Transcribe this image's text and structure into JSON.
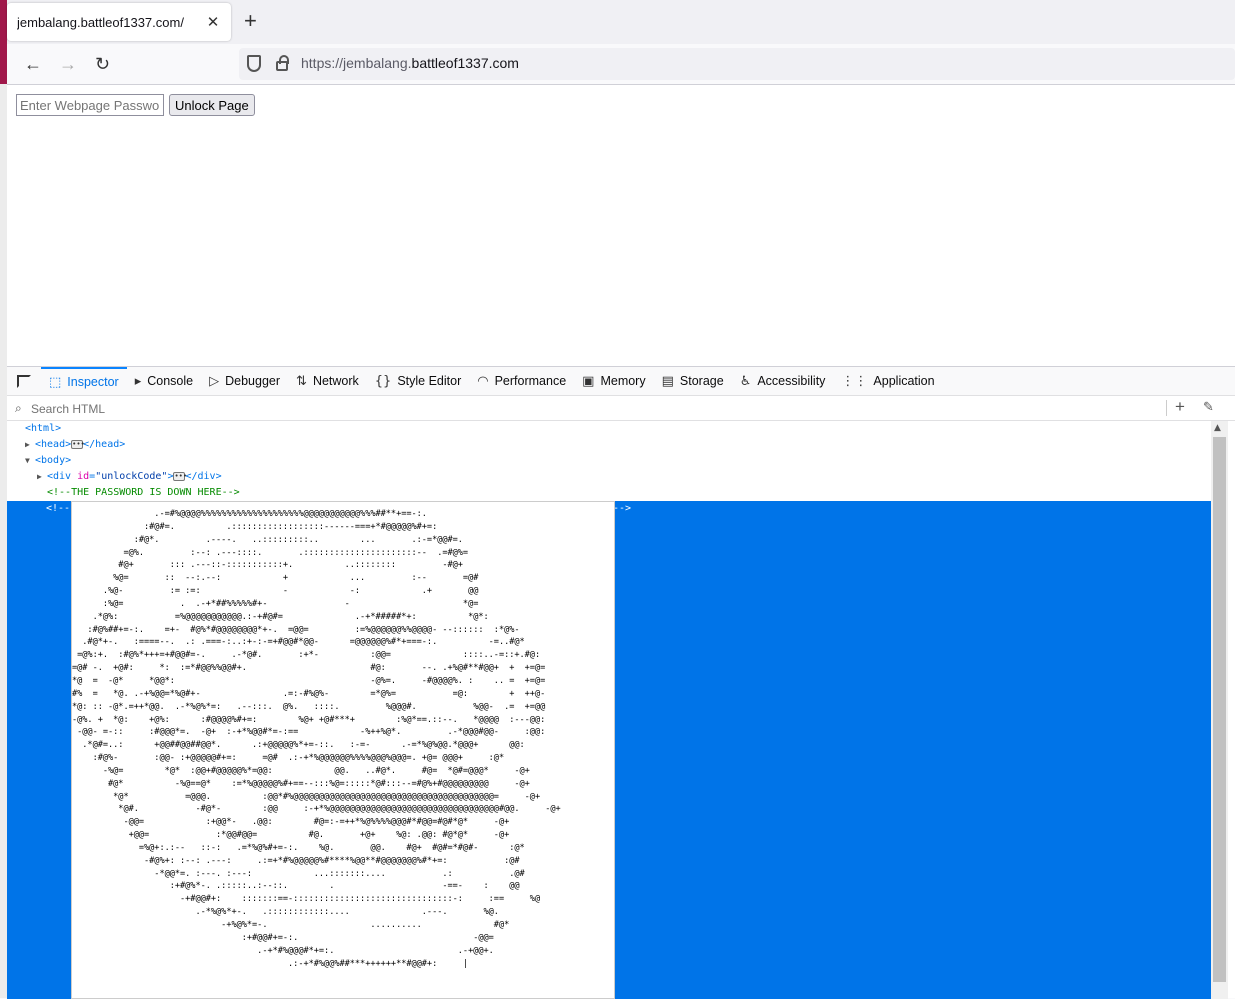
{
  "browser": {
    "tab_title": "jembalang.battleof1337.com/",
    "tab_close": "✕",
    "new_tab": "+",
    "url_prefix": "https://",
    "url_domain_plain": "jembalang.",
    "url_domain": "battleof1337.com"
  },
  "page": {
    "password_placeholder": "Enter Webpage Password",
    "unlock_label": "Unlock Page"
  },
  "devtools": {
    "tabs": [
      {
        "label": "Inspector",
        "icon": "⬚"
      },
      {
        "label": "Console",
        "icon": "▸"
      },
      {
        "label": "Debugger",
        "icon": "▷"
      },
      {
        "label": "Network",
        "icon": "⇅"
      },
      {
        "label": "Style Editor",
        "icon": "{}"
      },
      {
        "label": "Performance",
        "icon": "◠"
      },
      {
        "label": "Memory",
        "icon": "▣"
      },
      {
        "label": "Storage",
        "icon": "▤"
      },
      {
        "label": "Accessibility",
        "icon": "♿"
      },
      {
        "label": "Application",
        "icon": "⋮⋮"
      }
    ],
    "search_placeholder": "Search HTML",
    "markup": {
      "html_open": "<html>",
      "head_open": "<head>",
      "head_close": "</head>",
      "body_open": "<body>",
      "div_open_start": "<div ",
      "div_attr": "id",
      "div_val": "\"unlockCode\"",
      "div_open_end": ">",
      "div_close": "</div>",
      "comment1": "<!--THE PASSWORD IS DOWN HERE-->",
      "comment2_open": "<!--",
      "comment2_close": "-->",
      "ascii_art": "                .-=#%@@@@%%%%%%%%%%%%%%%%%%%%@@@@@@@@@@@%%%##**+==-:.\n              :#@#=.          .::::::::::::::::::------===+*#@@@@@%#+=:\n            :#@*.         .----.   ..:::::::::..        ...       .:-=*@@#=.\n          =@%.         :--: .---::::.       .::::::::::::::::::::::--  .=#@%=\n         #@+       ::: .---::-:::::::::::+.          ..::::::::         -#@+\n        %@=       ::  --:.--:            +            ...         :--       =@#\n      .%@-         := :=:                -            -:            .+       @@\n      :%@=           .  .-+*##%%%%%#+-               -                      *@=\n    .*@%:           =%@@@@@@@@@@@.:-+#@#=              .-+*#####*+:          *@*:\n   :#@%##+=-:.    =+-  #@%*#@@@@@@@@*+-.  =@@=         :=%@@@@@@%%@@@@- --::::::  :*@%-\n  .#@*+-.   :====--.  .: .===-:..:+-:-=+#@@#*@@-      =@@@@@@%#*+===-:.          -=..#@*\n =@%:+.  :#@%*+++=+#@@#=-.     .-*@#.       :+*-          :@@=              ::::..-=::+.#@:\n=@# -.  +@#:     *:  :=*#@@%%@@#+.                        #@:       --. .+%@#**#@@+  +  +=@=\n*@  =  -@*     *@@*:                                      -@%=.     -#@@@@%. :    .. =  +=@=\n#%  =   *@. .-+%@@=*%@#+-                .=:-#%@%-        =*@%=           =@:        +  ++@-\n*@: :: -@*.=++*@@.  .-*%@%*=:   .--:::.  @%.   ::::.         %@@@#.           %@@-  .=  +=@@\n-@%. +  *@:    +@%:      :#@@@@%#+=:        %@+ +@#***+        :%@*==.::--.   *@@@@  :---@@:\n -@@- =-::     :#@@@*=.  -@+  :-+*%@@#*=-:==            -%++%@*.         .-*@@@#@@-     :@@:\n  .*@#=..:      +@@##@@##@@*.      .:+@@@@@%*+=-::.   :-=-      .-=*%@%@@.*@@@+      @@:\n    :#@%-       :@@- :+@@@@@#+=:     =@#  .:-+*%@@@@@@%%%%@@@%@@@=. +@= @@@+     :@*\n      -%@=        *@*  :@@+#@@@@@%*=@@:            @@.   ..#@*.     #@=  *@#=@@@*     -@+\n       #@*          -%@==@*    :=*%@@@@@%#+==--:::%@=:::::*@#:::--=#@%+#@@@@@@@@@     -@+\n        *@*           =@@@.          :@@*#%@@@@@@@@@@@@@@@@@@@@@@@@@@@@@@@@@@@@@@@=     -@+\n         *@#.           -#@*-        :@@     :-+*%@@@@@@@@@@@@@@@@@@@@@@@@@@@@@@@@@#@@.     -@+\n          -@@=            :+@@*-   .@@:        #@=:-=++*%@%%%%@@@#*#@@=#@#*@*     -@+\n           +@@=             :*@@#@@=          #@.       +@+    %@: .@@: #@*@*     -@+\n             =%@+:.:--   ::-:   .=*%@%#+=-:.    %@.       @@.    #@+  #@#=*#@#-      :@*\n              -#@%+: :--: .---:     .:=+*#%@@@@@%#****%@@**#@@@@@@@%#*+=:           :@#\n                -*@@*=. :---. :---:            ...:::::::....           .:           .@#\n                   :+#@%*-. .:::::..:--::.        .                     -==-    :    @@\n                     -+#@@#+:    :::::::==-:::::::::::::::::::::::::::::::-:     :==     %@\n                        .-*%@%*+-.   .::::::::::::....              .---.       %@.\n                             -+%@%*=-.                    ..........              #@*\n                                 :+#@@#+=-:.                                  -@@=\n                                    .-+*#%@@@#*+=:.                        .-+@@+.\n                                          .:-+*#%@@%##***++++++**#@@#+:     |"
    }
  }
}
